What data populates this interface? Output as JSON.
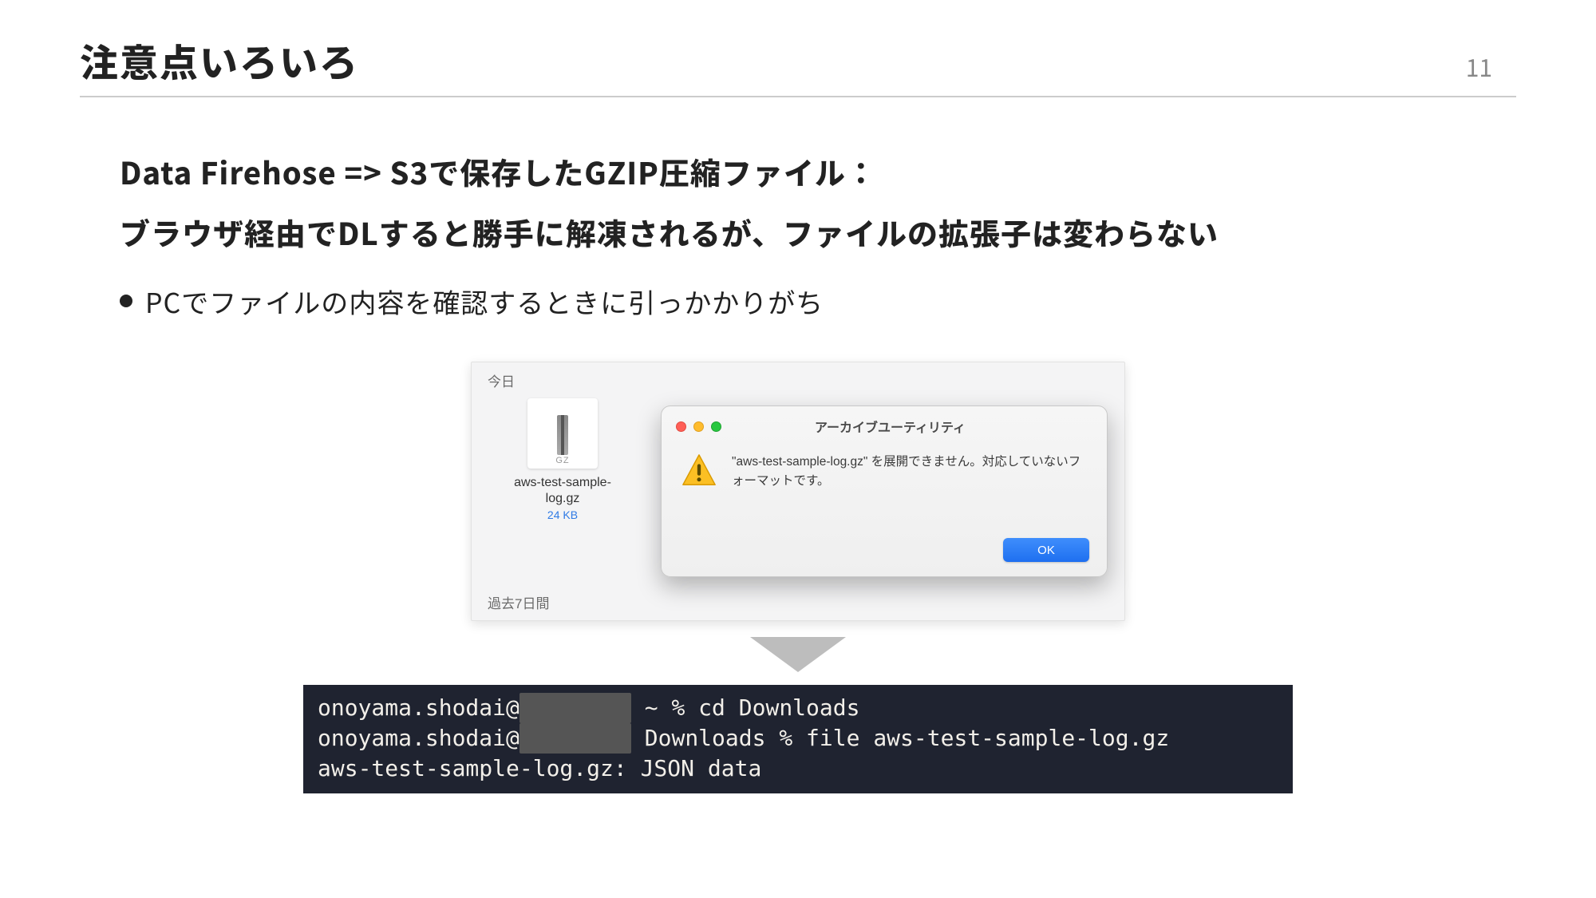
{
  "header": {
    "title": "注意点いろいろ",
    "page_number": "11"
  },
  "lead": {
    "line1": "Data Firehose => S3で保存したGZIP圧縮ファイル：",
    "line2": "ブラウザ経由でDLすると勝手に解凍されるが、ファイルの拡張子は変わらない"
  },
  "bullet1": "PCでファイルの内容を確認するときに引っかかりがち",
  "finder": {
    "section_today": "今日",
    "file_ext_badge": "GZ",
    "file_name_line1": "aws-test-sample-",
    "file_name_line2": "log.gz",
    "file_size": "24 KB",
    "section_past": "過去7日間"
  },
  "alert": {
    "window_title": "アーカイブユーティリティ",
    "message": "\"aws-test-sample-log.gz\" を展開できません。対応していないフォーマットです。",
    "ok_label": "OK"
  },
  "terminal": {
    "user": "onoyama.shodai",
    "host_redacted": "　　　　　",
    "line1_prefix": "onoyama.shodai@",
    "line1_suffix": " ~ % cd Downloads",
    "line2_prefix": "onoyama.shodai@",
    "line2_suffix": " Downloads % file aws-test-sample-log.gz",
    "line3": "aws-test-sample-log.gz: JSON data"
  }
}
